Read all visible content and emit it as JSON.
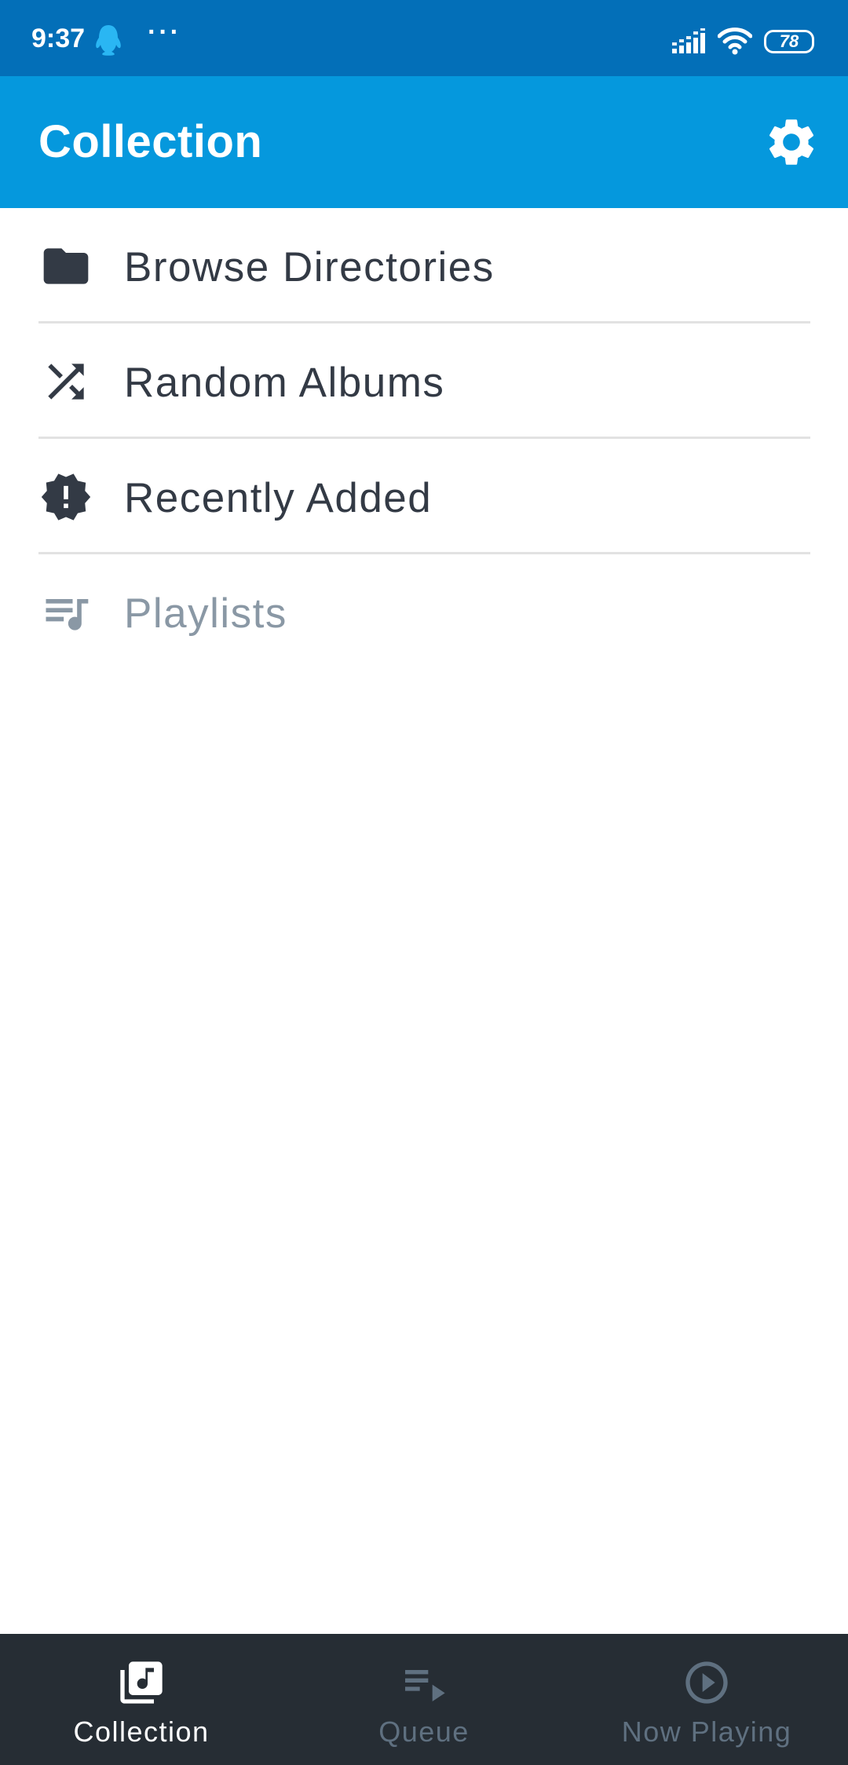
{
  "status_bar": {
    "time": "9:37",
    "dots": "···",
    "battery": "78",
    "icons": [
      "qq-icon",
      "more-dots",
      "signal-icon",
      "wifi-icon",
      "battery-icon"
    ]
  },
  "app_bar": {
    "title": "Collection",
    "settings_icon": "gear-icon"
  },
  "menu": {
    "items": [
      {
        "label": "Browse Directories",
        "icon": "folder-icon"
      },
      {
        "label": "Random Albums",
        "icon": "shuffle-icon"
      },
      {
        "label": "Recently Added",
        "icon": "new-releases-icon"
      },
      {
        "label": "Playlists",
        "icon": "playlist-music-icon"
      }
    ]
  },
  "bottom_nav": {
    "items": [
      {
        "label": "Collection",
        "icon": "library-music-icon",
        "active": true
      },
      {
        "label": "Queue",
        "icon": "queue-play-icon",
        "active": false
      },
      {
        "label": "Now Playing",
        "icon": "play-circle-icon",
        "active": false
      }
    ]
  },
  "colors": {
    "status_bar": "#036fb8",
    "app_bar": "#0598dd",
    "text_dark": "#333a45",
    "text_dim": "#8a98a5",
    "bottom_nav": "#262d34",
    "nav_inactive": "#5f7080"
  }
}
